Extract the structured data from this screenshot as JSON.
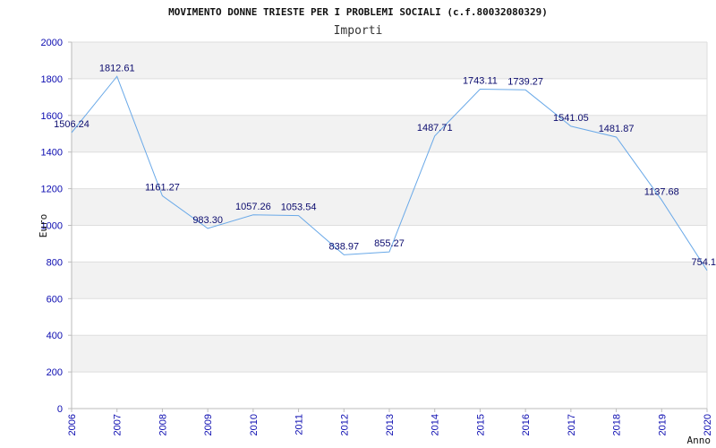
{
  "chart_data": {
    "type": "line",
    "title": "MOVIMENTO DONNE TRIESTE PER I PROBLEMI SOCIALI (c.f.80032080329)",
    "subtitle": "Importi",
    "xlabel": "Anno",
    "ylabel": "Euro",
    "ylim": [
      0,
      2000
    ],
    "yticks": [
      0,
      200,
      400,
      600,
      800,
      1000,
      1200,
      1400,
      1600,
      1800,
      2000
    ],
    "grid": true,
    "line_color": "#6aa9e8",
    "band_color": "#f2f2f2",
    "x": [
      "2006",
      "2007",
      "2008",
      "2009",
      "2010",
      "2011",
      "2012",
      "2013",
      "2014",
      "2015",
      "2016",
      "2017",
      "2018",
      "2019",
      "2020"
    ],
    "values": [
      1506.24,
      1812.61,
      1161.27,
      983.3,
      1057.26,
      1053.54,
      838.97,
      855.27,
      1487.71,
      1743.11,
      1739.27,
      1541.05,
      1481.87,
      1137.68,
      754.1
    ],
    "labels": [
      "1506.24",
      "1812.61",
      "1161.27",
      "983.30",
      "1057.26",
      "1053.54",
      "838.97",
      "855.27",
      "1487.71",
      "1743.11",
      "1739.27",
      "1541.05",
      "1481.87",
      "1137.68",
      "754.1"
    ]
  }
}
